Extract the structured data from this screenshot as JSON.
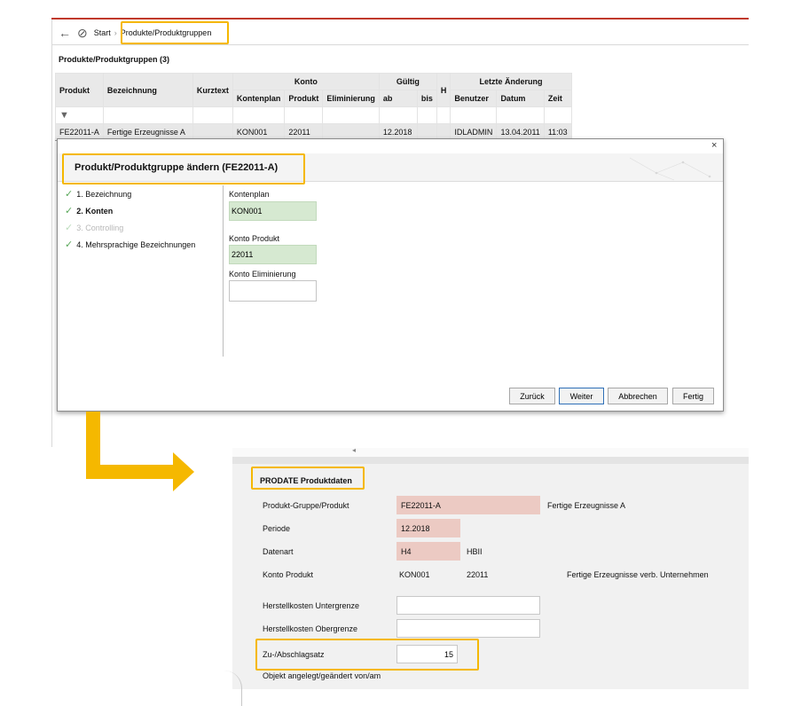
{
  "nav": {
    "back_icon": "arrow-left-icon",
    "block_icon": "prohibited-icon",
    "start": "Start",
    "separator": "›",
    "current": "Produkte/Produktgruppen"
  },
  "list": {
    "title": "Produkte/Produktgruppen (3)",
    "headers": {
      "produkt": "Produkt",
      "bezeichnung": "Bezeichnung",
      "kurztext": "Kurztext",
      "konto": "Konto",
      "kontenplan": "Kontenplan",
      "konto_produkt": "Produkt",
      "eliminierung": "Eliminierung",
      "gueltig": "Gültig",
      "ab": "ab",
      "bis": "bis",
      "h": "H",
      "letzte_aenderung": "Letzte Änderung",
      "benutzer": "Benutzer",
      "datum": "Datum",
      "zeit": "Zeit"
    },
    "filter_icon": "filter-icon",
    "row": {
      "produkt": "FE22011-A",
      "bezeichnung": "Fertige Erzeugnisse A",
      "kurztext": "",
      "kontenplan": "KON001",
      "konto_produkt": "22011",
      "eliminierung": "",
      "ab": "12.2018",
      "bis": "",
      "h": "",
      "benutzer": "IDLADMIN",
      "datum": "13.04.2011",
      "zeit": "11:03"
    }
  },
  "dialog": {
    "close": "×",
    "title": "Produkt/Produktgruppe ändern (FE22011-A)",
    "steps": [
      {
        "label": "1. Bezeichnung",
        "state": "done"
      },
      {
        "label": "2. Konten",
        "state": "active"
      },
      {
        "label": "3. Controlling",
        "state": "disabled"
      },
      {
        "label": "4. Mehrsprachige Bezeichnungen",
        "state": "done"
      }
    ],
    "check_icon": "✓",
    "fields": {
      "kontenplan_label": "Kontenplan",
      "kontenplan_value": "KON001",
      "konto_produkt_label": "Konto Produkt",
      "konto_produkt_value": "22011",
      "konto_eliminierung_label": "Konto Eliminierung",
      "konto_eliminierung_value": ""
    },
    "buttons": {
      "zurueck": "Zurück",
      "weiter": "Weiter",
      "abbrechen": "Abbrechen",
      "fertig": "Fertig"
    }
  },
  "form": {
    "title": "PRODATE Produktdaten",
    "tab_icon": "◂",
    "rows": {
      "produkt_gruppe_label": "Produkt-Gruppe/Produkt",
      "produkt_gruppe_value": "FE22011-A",
      "produkt_gruppe_desc": "Fertige Erzeugnisse A",
      "periode_label": "Periode",
      "periode_value": "12.2018",
      "datenart_label": "Datenart",
      "datenart_value": "H4",
      "datenart_desc": "HBII",
      "konto_produkt_label": "Konto Produkt",
      "konto_produkt_plan": "KON001",
      "konto_produkt_value": "22011",
      "konto_produkt_desc": "Fertige Erzeugnisse verb. Unternehmen",
      "herst_unter_label": "Herstellkosten Untergrenze",
      "herst_unter_value": "",
      "herst_ober_label": "Herstellkosten Obergrenze",
      "herst_ober_value": "",
      "zu_abschlag_label": "Zu-/Abschlagsatz",
      "zu_abschlag_value": "15",
      "objekt_label": "Objekt angelegt/geändert von/am"
    }
  },
  "colors": {
    "highlight": "#f5b800",
    "valid_field": "#d6e9d1",
    "key_field": "#eccac3",
    "accent_line": "#c0392b"
  }
}
